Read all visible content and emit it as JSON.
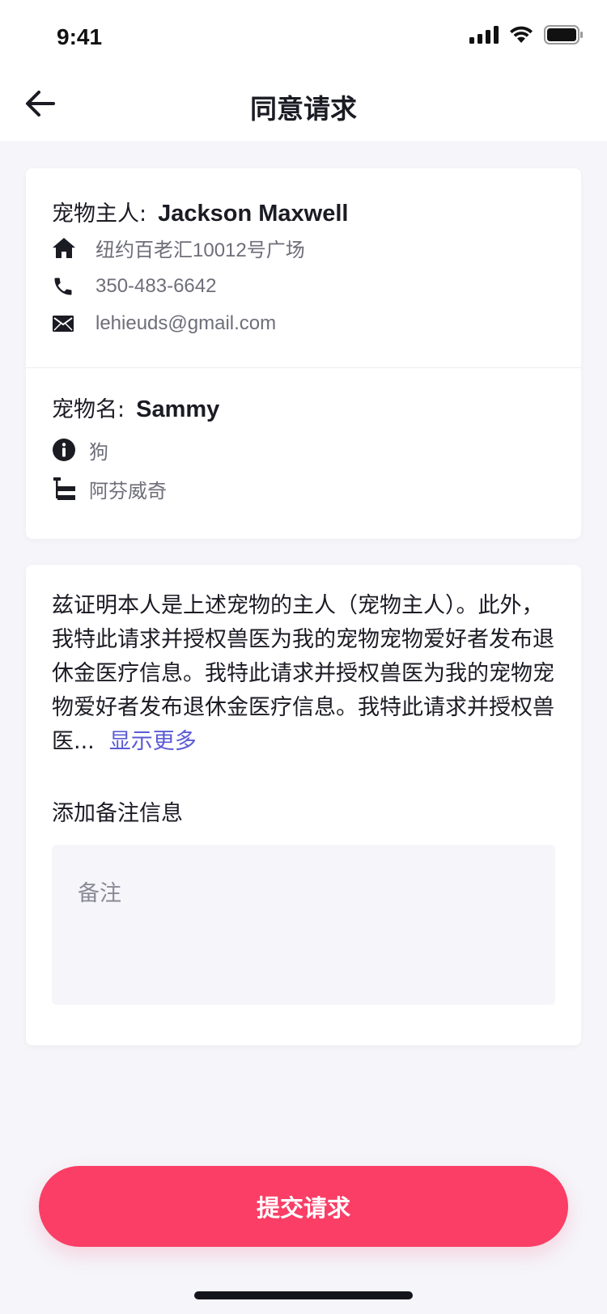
{
  "status_bar": {
    "time": "9:41",
    "icons": [
      "signal-icon",
      "wifi-icon",
      "battery-icon"
    ]
  },
  "nav": {
    "title": "同意请求",
    "back_icon": "arrow-left-icon"
  },
  "owner": {
    "label": "宠物主人:",
    "name": "Jackson Maxwell",
    "address_icon": "home-icon",
    "address": "纽约百老汇10012号广场",
    "phone_icon": "phone-icon",
    "phone": "350-483-6642",
    "email_icon": "mail-icon",
    "email": "lehieuds@gmail.com"
  },
  "pet": {
    "label": "宠物名:",
    "name": "Sammy",
    "type_icon": "info-icon",
    "type": "狗",
    "breed_icon": "breed-tree-icon",
    "breed": "阿芬威奇"
  },
  "consent": {
    "text": "兹证明本人是上述宠物的主人（宠物主人）。此外，我特此请求并授权兽医为我的宠物宠物爱好者发布退休金医疗信息。我特此请求并授权兽医为我的宠物宠物爱好者发布退休金医疗信息。我特此请求并授权兽医...",
    "show_more": "显示更多"
  },
  "notes": {
    "label": "添加备注信息",
    "placeholder": "备注",
    "value": ""
  },
  "submit": {
    "label": "提交请求"
  },
  "colors": {
    "accent": "#fa3e66",
    "link": "#5b5bd6",
    "background": "#f5f5fa"
  }
}
